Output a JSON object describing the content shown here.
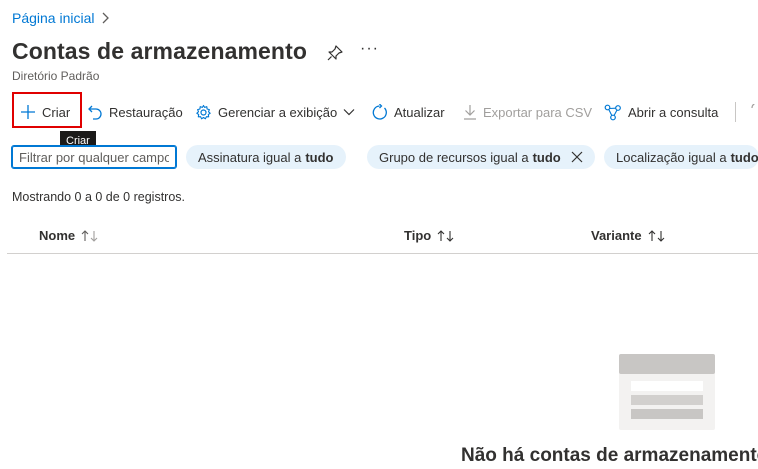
{
  "breadcrumb": {
    "home": "Página inicial"
  },
  "page": {
    "title": "Contas de armazenamento",
    "subtitle": "Diretório Padrão",
    "more": "···"
  },
  "toolbar": {
    "create": "Criar",
    "restore": "Restauração",
    "manage_view": "Gerenciar a exibição",
    "refresh": "Atualizar",
    "export_csv": "Exportar para CSV",
    "open_query": "Abrir a consulta"
  },
  "tooltip": {
    "text": "Criar"
  },
  "filters": {
    "placeholder": "Filtrar por qualquer campo...",
    "subscription": {
      "label": "Assinatura igual a",
      "value": "tudo"
    },
    "resource_group": {
      "label": "Grupo de recursos igual a",
      "value": "tudo"
    },
    "location": {
      "label": "Localização igual a",
      "value": "tudo"
    }
  },
  "list": {
    "count_text": "Mostrando 0 a 0 de 0 registros.",
    "columns": [
      "Nome",
      "Tipo",
      "Variante"
    ],
    "empty_text": "Não há contas de armazenamento"
  },
  "colors": {
    "accent": "#0078d4",
    "highlight_border": "#e00000",
    "pill_bg": "#e6f2fb"
  },
  "icons": [
    "chevron-right-icon",
    "pin-icon",
    "plus-icon",
    "undo-icon",
    "gear-icon",
    "chevron-down-icon",
    "refresh-icon",
    "download-icon",
    "query-icon",
    "close-icon",
    "sort-icon",
    "empty-state-icon"
  ]
}
